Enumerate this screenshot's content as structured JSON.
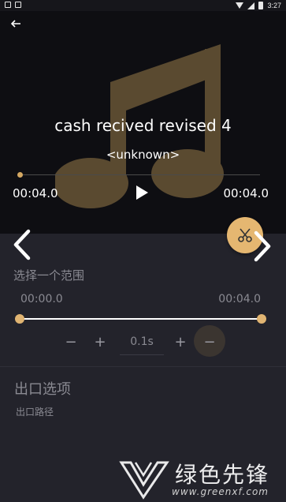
{
  "status_bar": {
    "time": "3:27"
  },
  "player": {
    "title": "cash recived revised 4",
    "artist": "<unknown>",
    "current_time": "00:04.0",
    "total_time": "00:04.0",
    "progress": 0.0
  },
  "range": {
    "label": "选择一个范围",
    "start": "00:00.0",
    "end": "00:04.0",
    "start_fraction": 0.0,
    "end_fraction": 1.0
  },
  "stepper": {
    "minus_left": "−",
    "plus_left": "+",
    "value": "0.1s",
    "plus_right": "+",
    "minus_right": "−"
  },
  "export": {
    "title": "出口选项",
    "path_label": "出口路径"
  },
  "watermark": {
    "text": "绿色先锋",
    "url": "www.greenxf.com"
  },
  "colors": {
    "accent": "#e5b771",
    "background": "#23232b",
    "player_background": "#0e0e12"
  },
  "icons": {
    "back": "arrow-left-icon",
    "play": "play-icon",
    "prev": "chevron-left-icon",
    "next": "chevron-right-icon",
    "scissors": "scissors-icon",
    "art": "music-note-icon"
  }
}
